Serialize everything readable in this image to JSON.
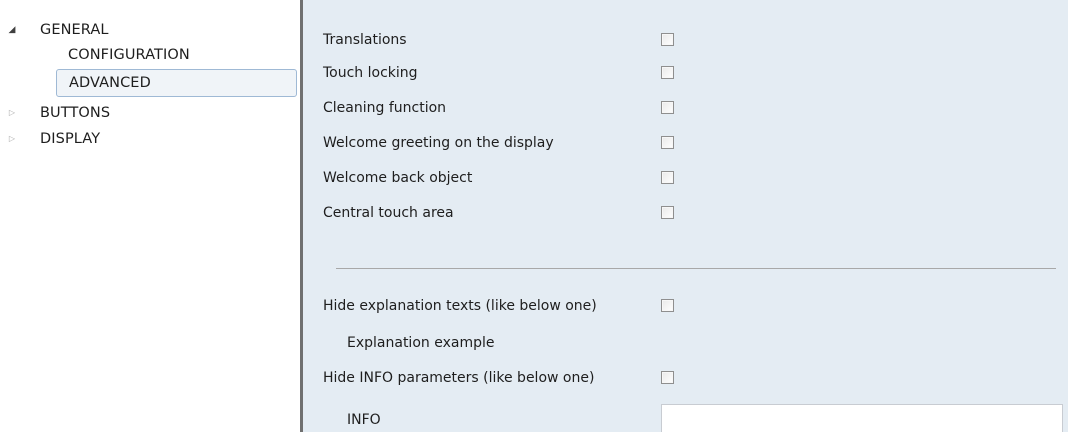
{
  "tree": {
    "items": [
      {
        "label": "GENERAL",
        "arrow": "expanded-triangle-icon"
      },
      {
        "label": "CONFIGURATION"
      },
      {
        "label": "ADVANCED",
        "selected": true
      },
      {
        "label": "BUTTONS",
        "arrow": "collapsed-triangle-icon"
      },
      {
        "label": "DISPLAY",
        "arrow": "collapsed-triangle-icon"
      }
    ]
  },
  "params": {
    "rows": [
      {
        "label": "Translations",
        "checked": false
      },
      {
        "label": "Touch locking",
        "checked": false
      },
      {
        "label": "Cleaning function",
        "checked": false
      },
      {
        "label": "Welcome greeting on the display",
        "checked": false
      },
      {
        "label": "Welcome back object",
        "checked": false
      },
      {
        "label": "Central touch area",
        "checked": false
      }
    ],
    "extra": [
      {
        "label": "Hide explanation texts (like below one)",
        "checked": false
      },
      {
        "label": "Explanation example"
      },
      {
        "label": "Hide INFO parameters (like below one)",
        "checked": false
      },
      {
        "label": "INFO",
        "value": ""
      }
    ]
  },
  "colors": {
    "params_background": "#e4ecf3",
    "selection_border": "#9fb9d5",
    "splitter": "#707070"
  }
}
